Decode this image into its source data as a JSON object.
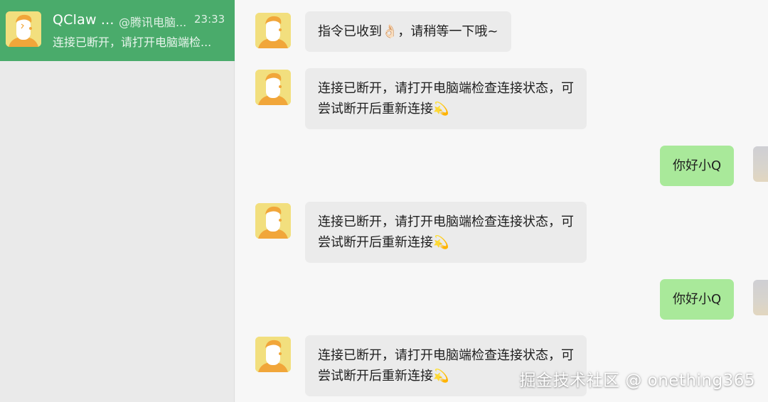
{
  "sidebar": {
    "chat_item": {
      "name": "QClaw ...",
      "group": "@腾讯电脑...",
      "time": "23:33",
      "preview": "连接已断开，请打开电脑端检...",
      "avatar_icon": "robot-avatar-icon"
    }
  },
  "conversation": {
    "messages": [
      {
        "side": "left",
        "text": "指令已收到👌🏻，请稍等一下哦~"
      },
      {
        "side": "left",
        "line1": "连接已断开，请打开电脑端检查连接状态，可",
        "line2": "尝试断开后重新连接💫"
      },
      {
        "side": "right",
        "text": "你好小Q"
      },
      {
        "side": "left",
        "line1": "连接已断开，请打开电脑端检查连接状态，可",
        "line2": "尝试断开后重新连接💫"
      },
      {
        "side": "right",
        "text": "你好小Q"
      },
      {
        "side": "left",
        "line1": "连接已断开，请打开电脑端检查连接状态，可",
        "line2": "尝试断开后重新连接💫"
      }
    ]
  },
  "watermark": "掘金技术社区 @ onething365",
  "colors": {
    "selected_chat": "#4aab6b",
    "left_bubble": "#ebebeb",
    "right_bubble": "#a9e99a",
    "avatar_bg": "#f2df7e"
  }
}
